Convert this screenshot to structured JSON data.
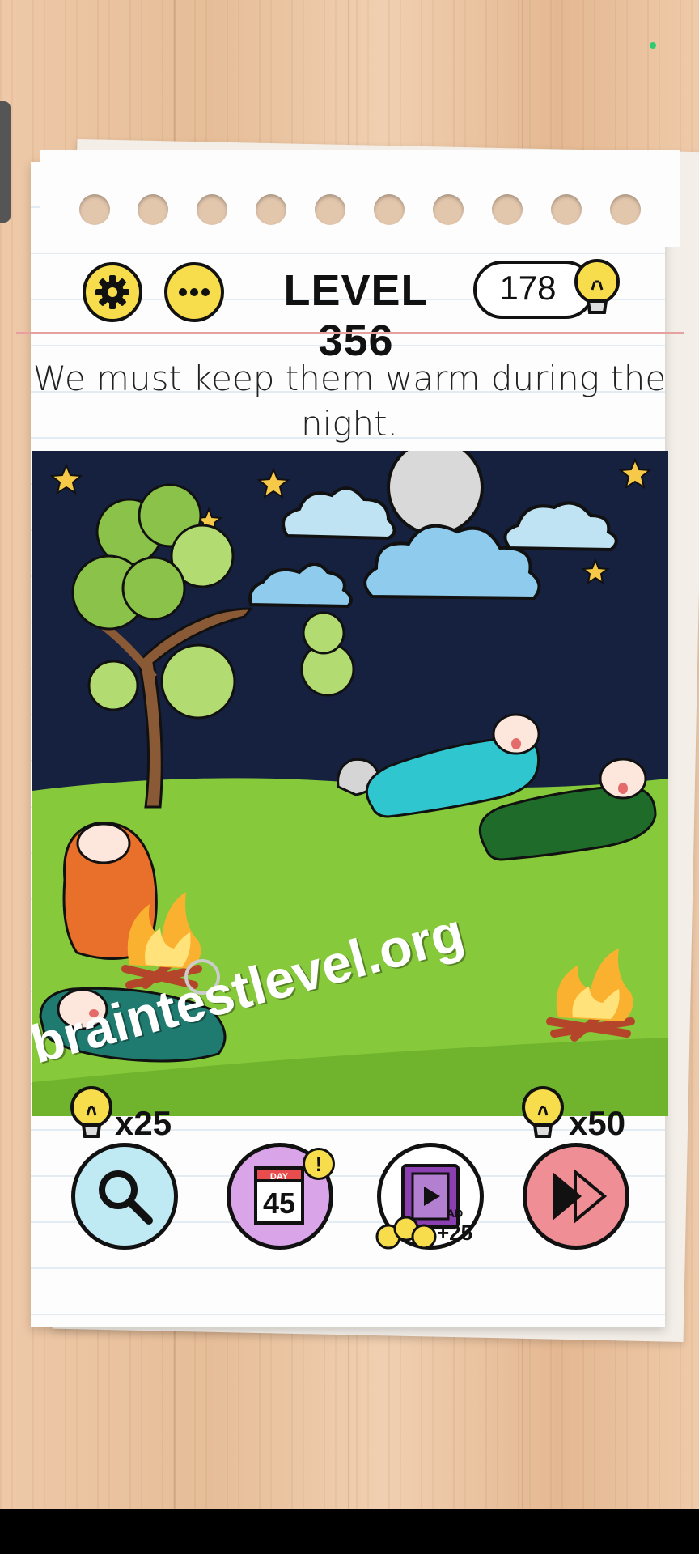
{
  "header": {
    "level_title": "LEVEL 356",
    "hint_count": "178"
  },
  "instruction": "We must keep them warm during the night.",
  "watermark": "braintestlevel.org",
  "tools": {
    "search_cost": "x25",
    "skip_cost": "x50",
    "daily_day_label": "DAY",
    "daily_day_number": "45",
    "daily_badge": "!",
    "ad_label": "AD",
    "ad_reward": "+25"
  },
  "icons": {
    "settings": "gear-icon",
    "more": "more-icon",
    "hint": "lightbulb-icon",
    "search": "magnifier-icon",
    "daily": "calendar-icon",
    "ad": "video-icon",
    "skip": "fast-forward-icon"
  },
  "colors": {
    "button_yellow": "#f7dd4b",
    "sky": "#15213f",
    "grass": "#86c93b",
    "search_bg": "#bfeaf3",
    "daily_bg": "#d9a4e8",
    "skip_bg": "#f08e95"
  }
}
